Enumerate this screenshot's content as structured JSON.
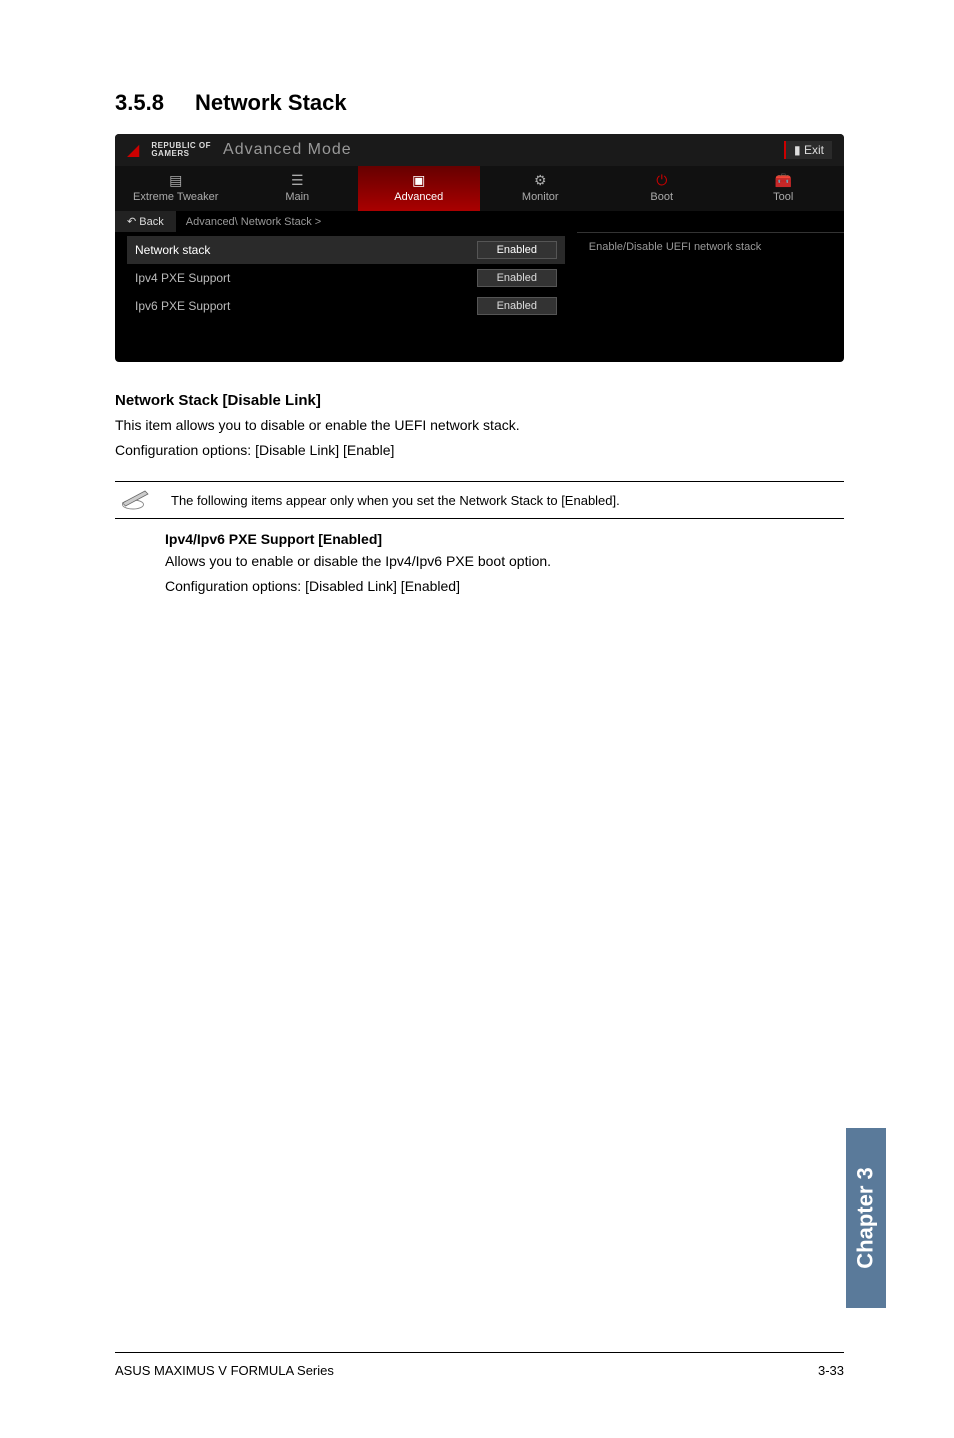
{
  "heading": {
    "number": "3.5.8",
    "title": "Network Stack"
  },
  "bios": {
    "brand_line1": "REPUBLIC OF",
    "brand_line2": "GAMERS",
    "mode": "Advanced Mode",
    "exit": "Exit",
    "tabs": {
      "extreme": "Extreme Tweaker",
      "main": "Main",
      "advanced": "Advanced",
      "monitor": "Monitor",
      "boot": "Boot",
      "tool": "Tool"
    },
    "back": "Back",
    "breadcrumb": "Advanced\\ Network Stack >",
    "settings": {
      "network_stack": {
        "label": "Network stack",
        "value": "Enabled"
      },
      "ipv4": {
        "label": "Ipv4 PXE Support",
        "value": "Enabled"
      },
      "ipv6": {
        "label": "Ipv6 PXE Support",
        "value": "Enabled"
      }
    },
    "help": "Enable/Disable UEFI network stack"
  },
  "section1": {
    "title": "Network Stack [Disable Link]",
    "desc": "This item allows you to disable or enable the UEFI network stack.",
    "config": "Configuration options: [Disable Link] [Enable]"
  },
  "note": "The following items appear only when you set the Network Stack to [Enabled].",
  "section2": {
    "title": "Ipv4/Ipv6 PXE Support [Enabled]",
    "desc": "Allows you to enable or disable the Ipv4/Ipv6 PXE boot option.",
    "config": "Configuration options: [Disabled Link] [Enabled]"
  },
  "chapter_tab": "Chapter 3",
  "footer": {
    "left": "ASUS MAXIMUS V FORMULA Series",
    "right": "3-33"
  }
}
